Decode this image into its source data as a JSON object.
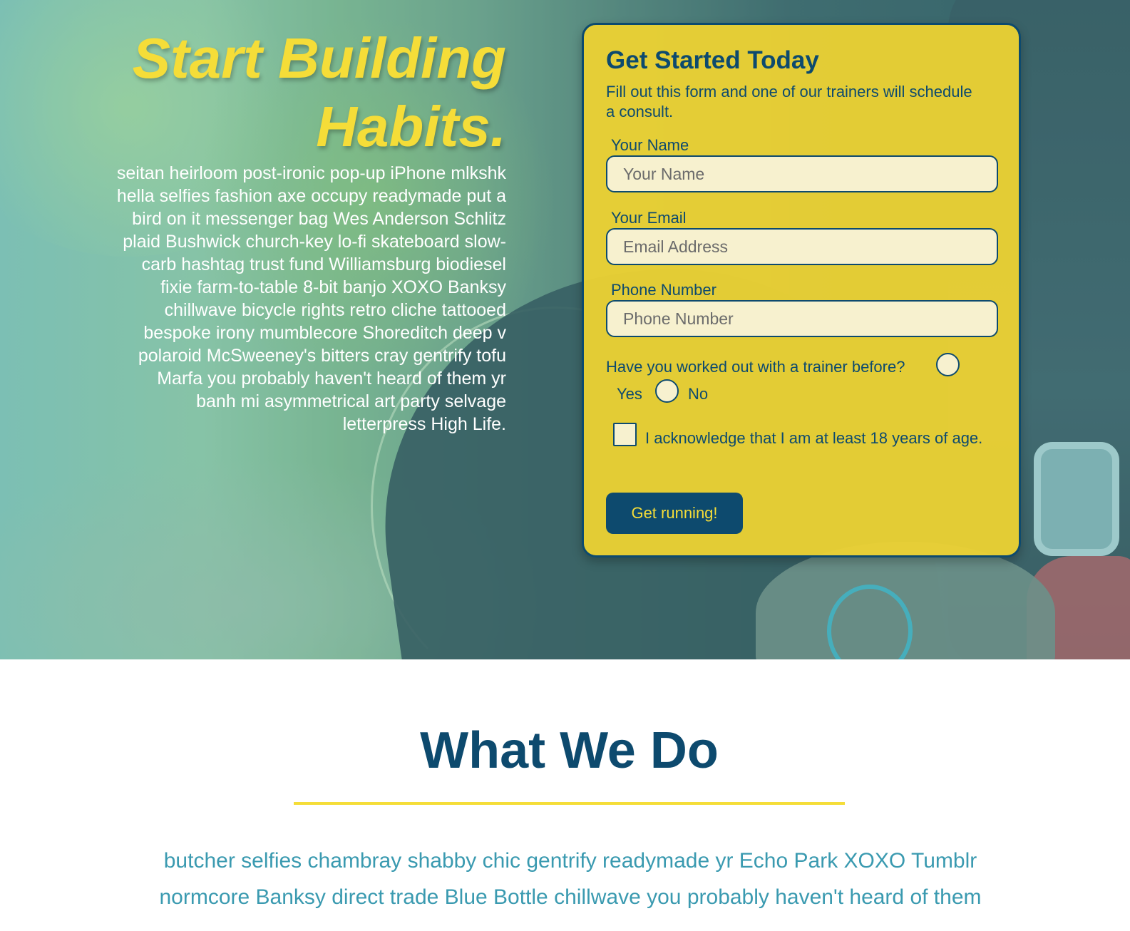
{
  "hero": {
    "heading": "Start Building Habits.",
    "body": "seitan heirloom post-ironic pop-up iPhone mlkshk hella selfies fashion axe occupy readymade put a bird on it messenger bag Wes Anderson Schlitz plaid Bushwick church-key lo-fi skateboard slow-carb hashtag trust fund Williamsburg biodiesel fixie farm-to-table 8-bit banjo XOXO Banksy chillwave bicycle rights retro cliche tattooed bespoke irony mumblecore Shoreditch deep v polaroid McSweeney's bitters cray gentrify tofu Marfa you probably haven't heard of them yr banh mi asymmetrical art party selvage letterpress High Life."
  },
  "form": {
    "title": "Get Started Today",
    "subtitle": "Fill out this form and one of our trainers will schedule a consult.",
    "name_label": "Your Name",
    "name_placeholder": "Your Name",
    "name_value": "",
    "email_label": "Your Email",
    "email_placeholder": "Email Address",
    "email_value": "",
    "phone_label": "Phone Number",
    "phone_placeholder": "Phone Number",
    "phone_value": "",
    "trainer_question": "Have you worked out with a trainer before?",
    "radio_options": [
      "Yes",
      "No"
    ],
    "age_acknowledgement": "I acknowledge that I am at least 18 years of age.",
    "submit_label": "Get running!"
  },
  "what_we_do": {
    "title": "What We Do",
    "body": "butcher selfies chambray shabby chic gentrify readymade yr Echo Park XOXO Tumblr normcore Banksy direct trade Blue Bottle chillwave you probably haven't heard of them"
  },
  "colors": {
    "brand_navy": "#0d4a6e",
    "brand_yellow": "#f5dd38",
    "body_teal": "#3a9ab0",
    "form_bg": "#eed232"
  }
}
